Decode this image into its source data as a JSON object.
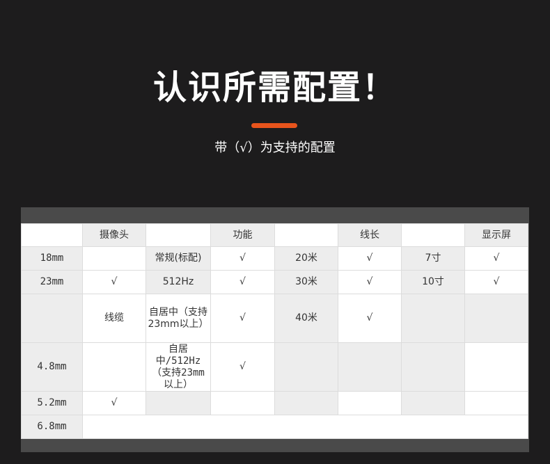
{
  "page": {
    "title": "认识所需配置！",
    "subtitle": "带（√）为支持的配置",
    "accent_color": "#e8541c"
  },
  "table": {
    "headers": [
      "",
      "摄像头",
      "",
      "功能",
      "",
      "线长",
      "",
      "显示屏"
    ],
    "rows": [
      [
        "18mm",
        "",
        "常规(标配)",
        "√",
        "20米",
        "√",
        "7寸",
        "√"
      ],
      [
        "23mm",
        "√",
        "512Hz",
        "√",
        "30米",
        "√",
        "10寸",
        "√"
      ],
      [
        "",
        "线缆",
        "自居中（支持23mm以上）",
        "√",
        "40米",
        "√",
        "",
        ""
      ],
      [
        "4.8mm",
        "",
        "自居中/512Hz（支持23mm以上）",
        "√",
        "",
        "",
        "",
        ""
      ],
      [
        "5.2mm",
        "√",
        "",
        "",
        "",
        "",
        "",
        ""
      ],
      [
        "6.8mm"
      ]
    ]
  }
}
